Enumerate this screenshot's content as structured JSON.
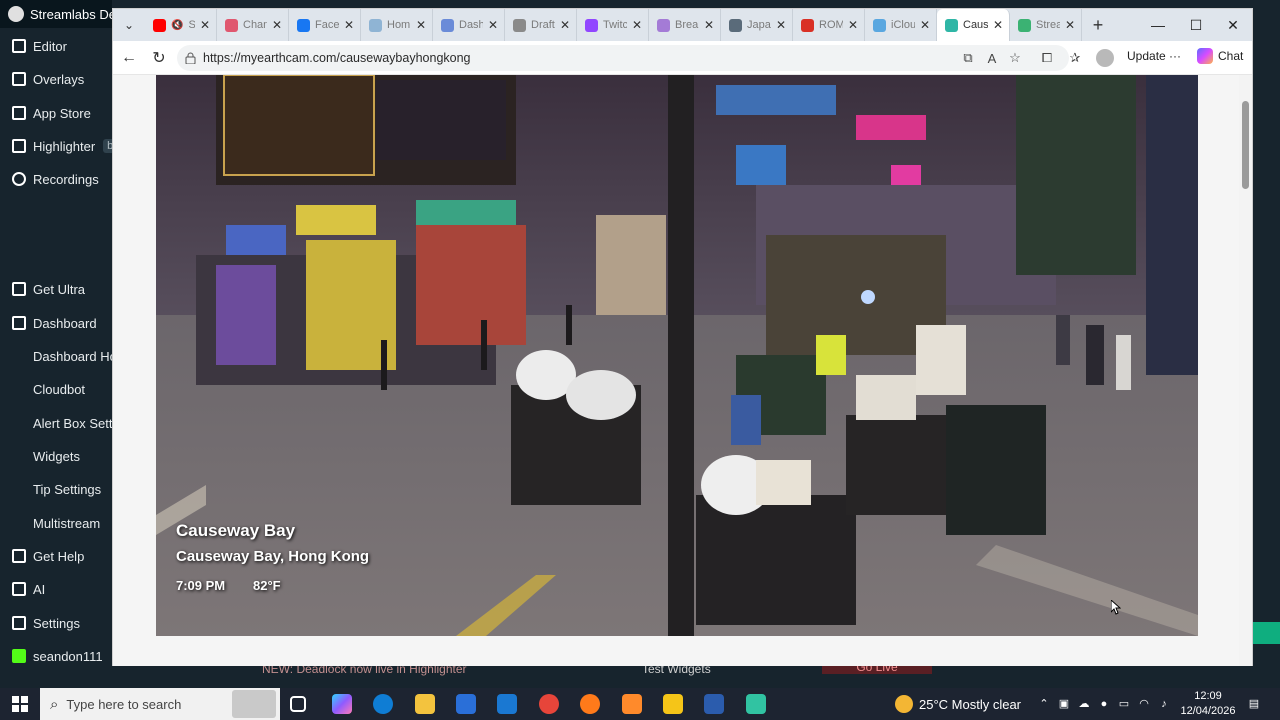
{
  "streamlabs": {
    "title": "Streamlabs Desktop",
    "nav": [
      {
        "label": "Editor",
        "icon": "editor-icon"
      },
      {
        "label": "Overlays",
        "icon": "overlays-icon"
      },
      {
        "label": "App Store",
        "icon": "app-store-icon"
      },
      {
        "label": "Highlighter",
        "icon": "highlighter-icon",
        "badge": "beta"
      },
      {
        "label": "Recordings",
        "icon": "recordings-icon"
      },
      {
        "label": "Get Ultra",
        "icon": "ultra-icon"
      },
      {
        "label": "Dashboard",
        "icon": "dashboard-icon"
      },
      {
        "label": "Dashboard Home",
        "sub": true
      },
      {
        "label": "Cloudbot",
        "sub": true
      },
      {
        "label": "Alert Box Settings",
        "sub": true
      },
      {
        "label": "Widgets",
        "sub": true
      },
      {
        "label": "Tip Settings",
        "sub": true
      },
      {
        "label": "Multistream",
        "sub": true
      },
      {
        "label": "Get Help",
        "icon": "help-icon"
      },
      {
        "label": "AI",
        "icon": "ai-icon"
      },
      {
        "label": "Settings",
        "icon": "settings-icon"
      },
      {
        "label": "seandon111",
        "icon": "kick-icon"
      }
    ],
    "bottom_banner": "NEW: Deadlock now live in Highlighter",
    "test_widgets": "Test Widgets",
    "go_live": "Go Live"
  },
  "browser": {
    "tabs": [
      {
        "label": "S",
        "color": "#ff0000",
        "muted": true
      },
      {
        "label": "Chan",
        "color": "#e0576f"
      },
      {
        "label": "Faceb",
        "color": "#1877f2"
      },
      {
        "label": "Hom",
        "color": "#8fb4d4"
      },
      {
        "label": "Dashb",
        "color": "#6a8bd8"
      },
      {
        "label": "Draft",
        "color": "#8a8a8a"
      },
      {
        "label": "Twitc",
        "color": "#9146ff"
      },
      {
        "label": "Break",
        "color": "#a47bd6"
      },
      {
        "label": "Japa",
        "color": "#5a6b7a"
      },
      {
        "label": "ROM",
        "color": "#d93025"
      },
      {
        "label": "iClou",
        "color": "#5aa7e0"
      },
      {
        "label": "Caus",
        "color": "#2fb6a6",
        "active": true
      },
      {
        "label": "Strea",
        "color": "#3bb273"
      }
    ],
    "url": "https://myearthcam.com/causewaybayhongkong",
    "update_label": "Update",
    "chat_label": "Chat"
  },
  "video": {
    "title": "Causeway Bay",
    "location": "Causeway Bay, Hong Kong",
    "time": "7:09 PM",
    "temperature": "82°F"
  },
  "taskbar": {
    "search_placeholder": "Type here to search",
    "weather": "25°C  Mostly clear",
    "time": "12:09",
    "date": "12/04/2026"
  }
}
